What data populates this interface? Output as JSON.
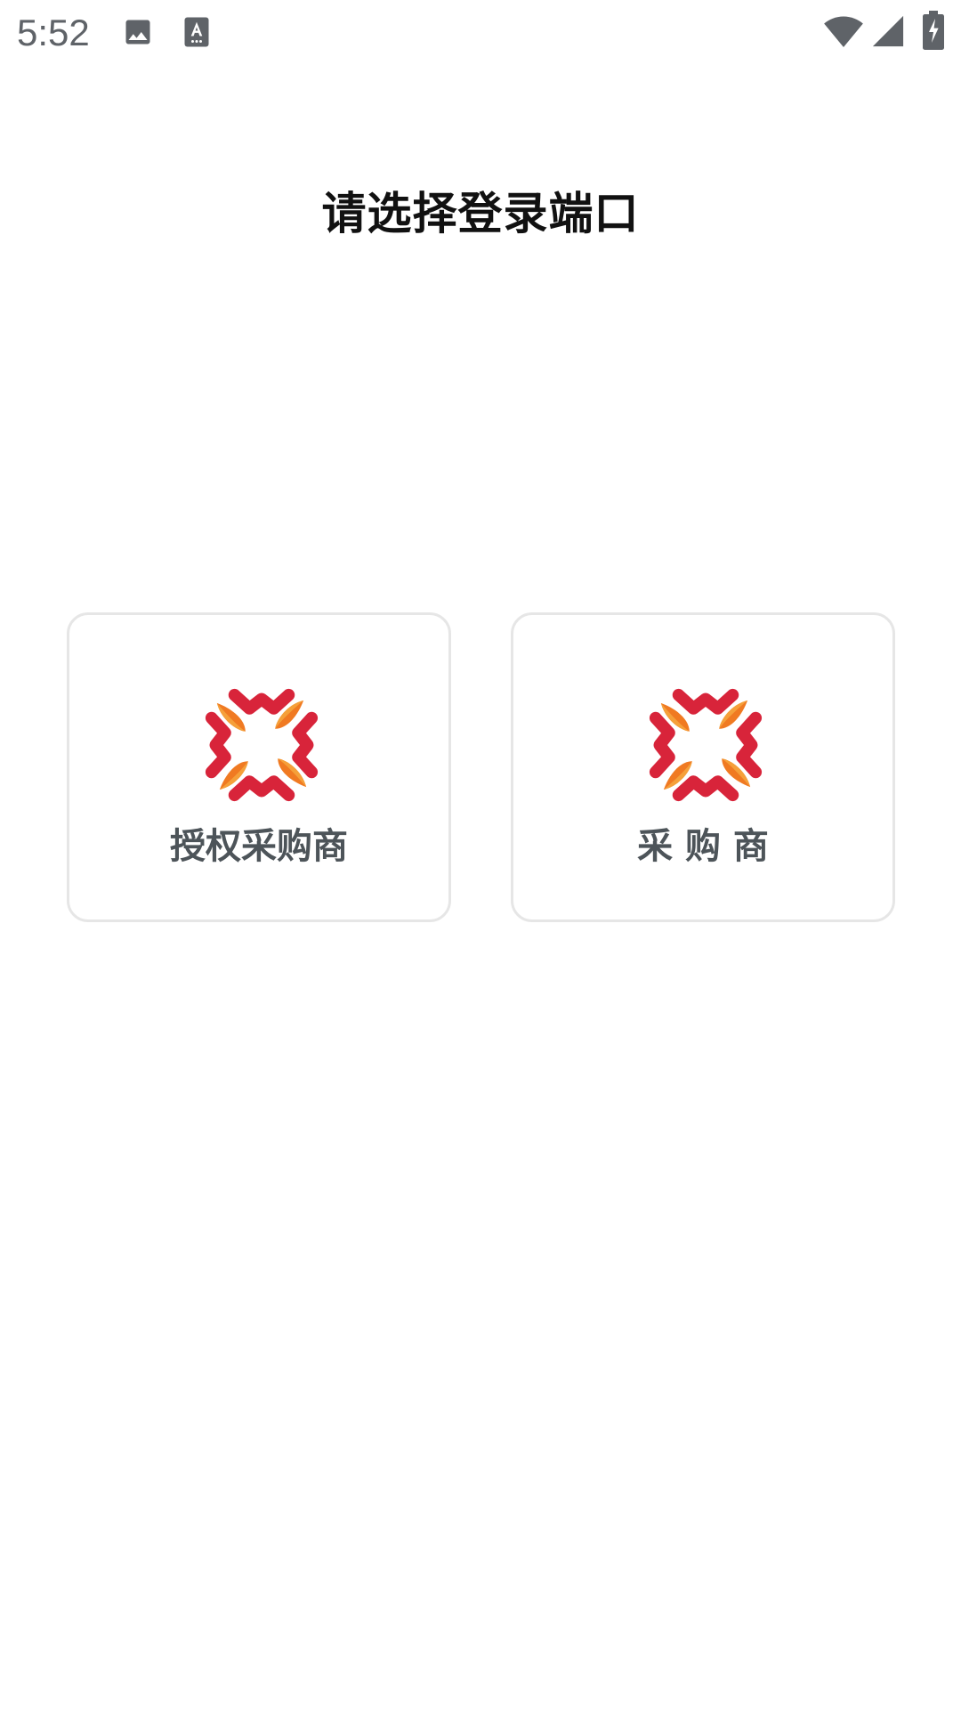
{
  "status_bar": {
    "time": "5:52",
    "icons": [
      "image-icon",
      "a11y-text-icon",
      "wifi-icon",
      "cell-signal-icon",
      "battery-charging-icon"
    ]
  },
  "page": {
    "title": "请选择登录端口"
  },
  "options": [
    {
      "label": "授权采购商",
      "logo": "pinwheel-heart-logo"
    },
    {
      "label": "采 购 商",
      "logo": "pinwheel-heart-logo"
    }
  ],
  "colors": {
    "logo_red": "#d8243a",
    "logo_orange": "#f07a22",
    "logo_orange_light": "#f5a03a",
    "label_gray": "#4d5459",
    "card_border": "#e6e6e6"
  }
}
